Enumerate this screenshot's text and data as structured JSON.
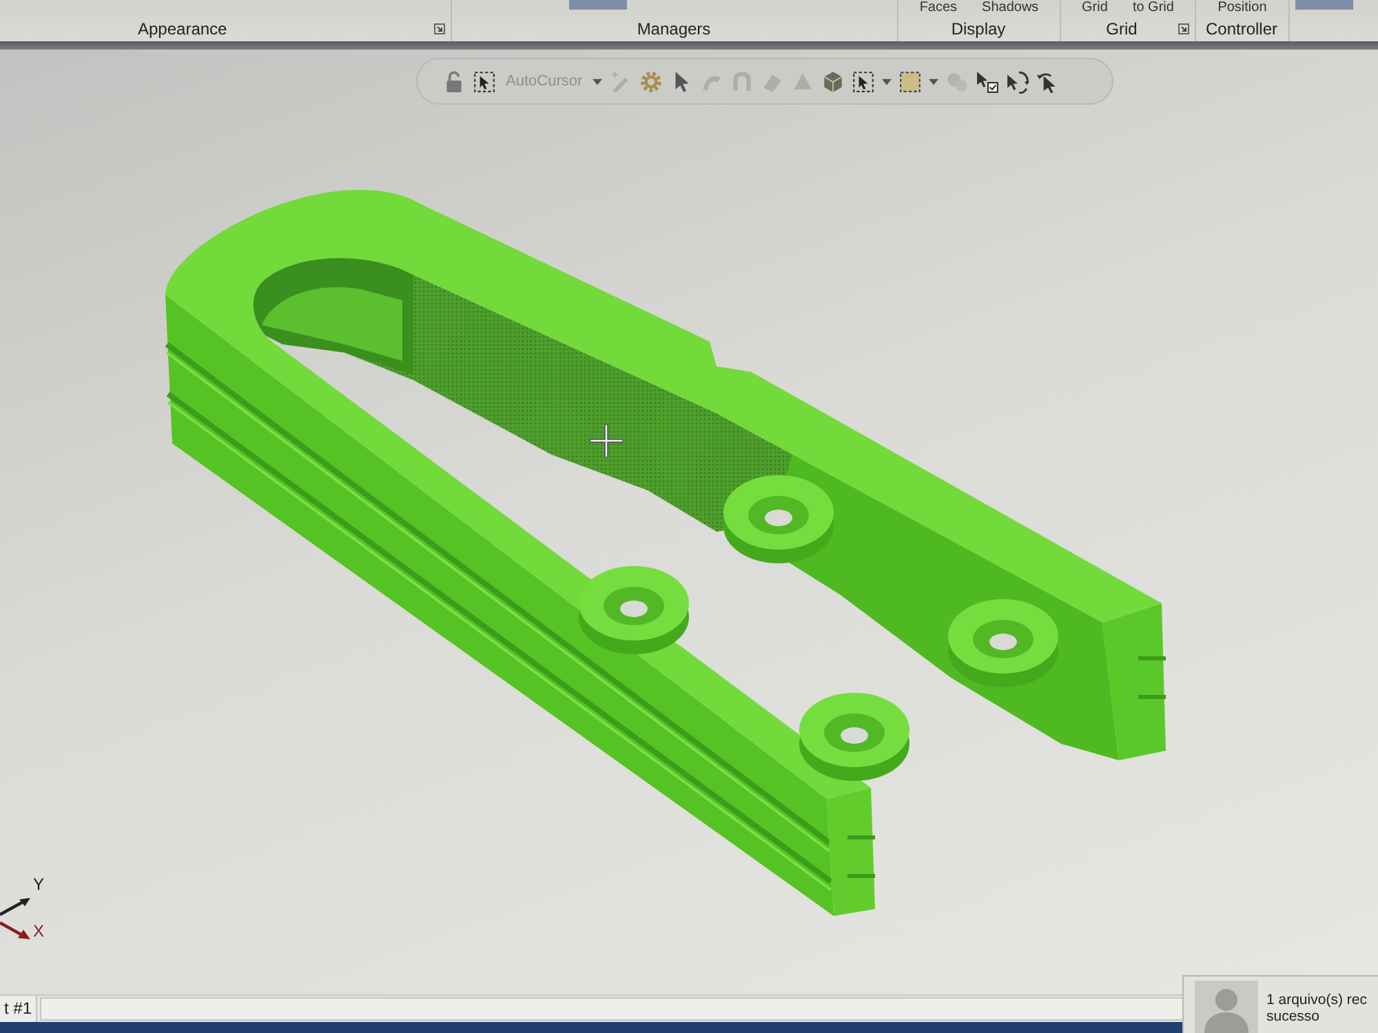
{
  "ribbon": {
    "groups": [
      {
        "label": "Appearance",
        "launcher": true
      },
      {
        "label": "Managers",
        "launcher": false,
        "buttons": [
          {
            "selected": true
          }
        ]
      },
      {
        "label": "Display",
        "launcher": false,
        "buttons": [
          {
            "label": "Faces",
            "selected": false
          },
          {
            "label": "Shadows",
            "selected": false
          }
        ]
      },
      {
        "label": "Grid",
        "launcher": true,
        "buttons": [
          {
            "label": "Grid",
            "selected": false
          },
          {
            "label": "to Grid",
            "selected": false
          }
        ]
      },
      {
        "label": "Controller",
        "launcher": false,
        "buttons": [
          {
            "label": "Position",
            "selected": false
          }
        ]
      },
      {
        "buttons": [
          {
            "selected": true
          }
        ]
      }
    ]
  },
  "toolbar": {
    "tools": [
      {
        "kind": "lock",
        "disabled": false
      },
      {
        "kind": "select",
        "disabled": false
      },
      {
        "kind": "dropdown",
        "label": "AutoCursor"
      },
      {
        "kind": "caret"
      },
      {
        "kind": "pencil",
        "disabled": true
      },
      {
        "kind": "gear",
        "disabled": false
      },
      {
        "kind": "pointer",
        "disabled": false
      },
      {
        "kind": "curve",
        "disabled": true
      },
      {
        "kind": "arch",
        "disabled": true
      },
      {
        "kind": "prism",
        "disabled": true
      },
      {
        "kind": "pyramid",
        "disabled": true
      },
      {
        "kind": "cube",
        "disabled": false
      },
      {
        "kind": "select",
        "disabled": false
      },
      {
        "kind": "caret"
      },
      {
        "kind": "marquee",
        "disabled": false
      },
      {
        "kind": "caret"
      },
      {
        "kind": "circles",
        "disabled": true
      },
      {
        "kind": "pointer-check",
        "disabled": false
      },
      {
        "kind": "pointer-rotate",
        "disabled": false
      },
      {
        "kind": "pointer-undo",
        "disabled": false
      }
    ]
  },
  "viewport": {
    "axes": [
      {
        "label": "Y",
        "color": "#222222"
      },
      {
        "label": "X",
        "color": "#8b1c1c"
      }
    ]
  },
  "status_bar": {
    "tab": "t #1"
  },
  "notification": {
    "lines": [
      "1 arquivo(s) rec",
      "sucesso"
    ]
  }
}
